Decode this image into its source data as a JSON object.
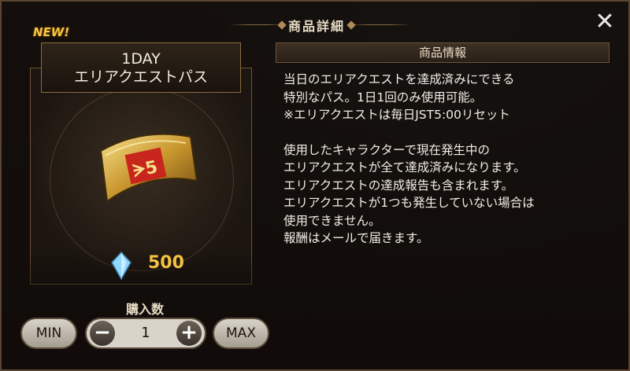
{
  "modal": {
    "title": "商品詳細",
    "close_label": "✕"
  },
  "item": {
    "new_badge": "NEW!",
    "name_line1": "1DAY",
    "name_line2": "エリアクエストパス",
    "icon": "area-quest-pass-ticket-icon",
    "currency_icon": "crystal-icon",
    "price": "500"
  },
  "purchase": {
    "quantity_label": "購入数",
    "min_label": "MIN",
    "max_label": "MAX",
    "decrement_label": "−",
    "increment_label": "+",
    "quantity": "1"
  },
  "info": {
    "header": "商品情報",
    "lines_a": [
      "当日のエリアクエストを達成済みにできる",
      "特別なパス。1日1回のみ使用可能。",
      "※エリアクエストは毎日JST5:00リセット"
    ],
    "lines_b": [
      "使用したキャラクターで現在発生中の",
      "エリアクエストが全て達成済みになります。",
      "エリアクエストの達成報告も含まれます。",
      "エリアクエストが1つも発生していない場合は",
      "使用できません。",
      "報酬はメールで届きます。"
    ]
  },
  "colors": {
    "accent_gold": "#f2c240",
    "frame_brown": "#6d5434"
  }
}
